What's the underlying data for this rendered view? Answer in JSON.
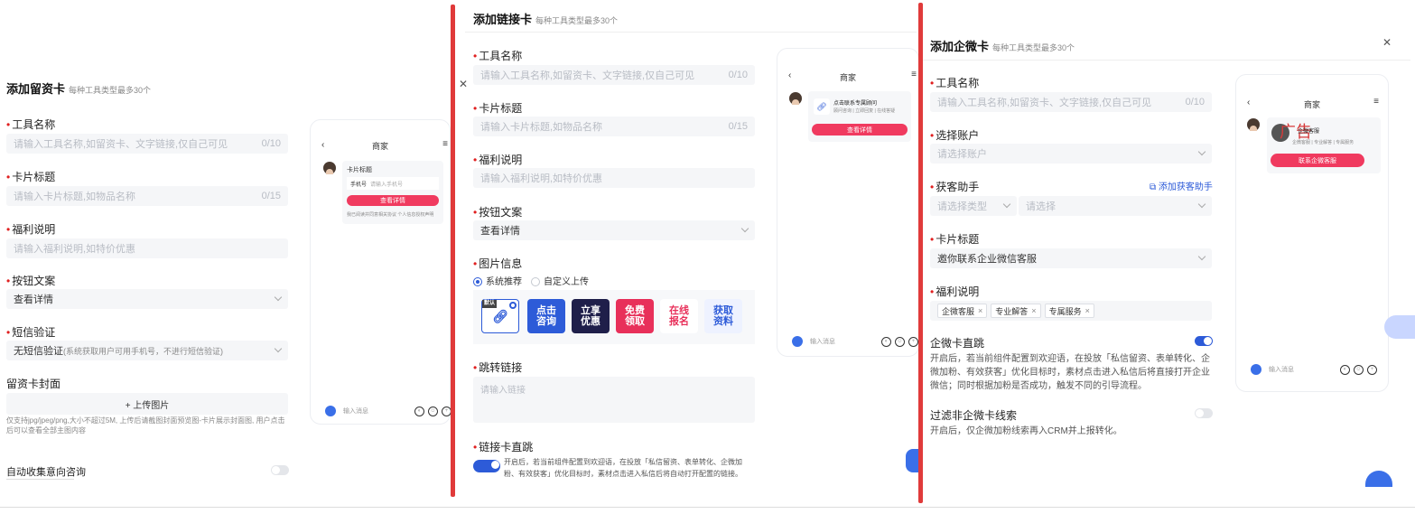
{
  "panel1": {
    "title": "添加留资卡",
    "subtitle": "每种工具类型最多30个",
    "field_name_label": "工具名称",
    "field_name_placeholder": "请输入工具名称,如留资卡、文字链接,仅自己可见",
    "field_name_count": "0/10",
    "card_title_label": "卡片标题",
    "card_title_placeholder": "请输入卡片标题,如物品名称",
    "card_title_count": "0/15",
    "benefit_label": "福利说明",
    "benefit_placeholder": "请输入福利说明,如特价优惠",
    "button_label": "按钮文案",
    "button_value": "查看详情",
    "sms_label": "短信验证",
    "sms_value": "无短信验证",
    "sms_note": "(系统获取用户可用手机号，不进行短信验证)",
    "cover_label": "留资卡封面",
    "upload_label": "+ 上传图片",
    "upload_hint": "仅支持jpg/jpeg/png,大小不超过5M, 上传后请截图封面预览图-卡片展示封面图, 用户点击后可以查看全部主图内容",
    "auto_collect_label": "自动收集意向咨询",
    "phone": {
      "header": "商家",
      "card_title": "卡片标题",
      "phone_label": "手机号",
      "phone_placeholder": "请输入手机号",
      "btn": "查看详情",
      "agree": "我已阅读并同意相关协议 个人信息授权声明",
      "input_placeholder": "输入消息"
    }
  },
  "panel2": {
    "title": "添加链接卡",
    "subtitle": "每种工具类型最多30个",
    "field_name_label": "工具名称",
    "field_name_placeholder": "请输入工具名称,如留资卡、文字链接,仅自己可见",
    "field_name_count": "0/10",
    "card_title_label": "卡片标题",
    "card_title_placeholder": "请输入卡片标题,如物品名称",
    "card_title_count": "0/15",
    "benefit_label": "福利说明",
    "benefit_placeholder": "请输入福利说明,如特价优惠",
    "button_label": "按钮文案",
    "button_value": "查看详情",
    "image_label": "图片信息",
    "radio_system": "系统推荐",
    "radio_custom": "自定义上传",
    "default_badge": "默认",
    "thumbs": [
      "点击咨询",
      "立享优惠",
      "免费领取",
      "在线报名",
      "获取资料"
    ],
    "jump_label": "跳转链接",
    "jump_placeholder": "请输入链接",
    "direct_label": "链接卡直跳",
    "direct_desc": "开启后，若当前组件配置到欢迎语，在投放「私信留资、表单转化、企微加粉、有效获客」优化目标时，素材点击进入私信后将自动打开配置的链接。",
    "phone": {
      "header": "商家",
      "card_line1": "点击联系专属顾问",
      "card_line2": "顾问咨询 | 立即回复 | 在线答疑",
      "btn": "查看详情",
      "input_placeholder": "输入消息"
    }
  },
  "panel3": {
    "title": "添加企微卡",
    "subtitle": "每种工具类型最多30个",
    "field_name_label": "工具名称",
    "field_name_placeholder": "请输入工具名称,如留资卡、文字链接,仅自己可见",
    "field_name_count": "0/10",
    "account_label": "选择账户",
    "account_placeholder": "请选择账户",
    "helper_label": "获客助手",
    "helper_add": "添加获客助手",
    "helper_type_placeholder": "请选择类型",
    "helper_placeholder": "请选择",
    "card_title_label": "卡片标题",
    "card_title_value": "邀你联系企业微信客服",
    "benefit_label": "福利说明",
    "tags": [
      "企微客服",
      "专业解答",
      "专属服务"
    ],
    "direct_label": "企微卡直跳",
    "direct_desc": "开启后，若当前组件配置到欢迎语，在投放「私信留资、表单转化、企微加粉、有效获客」优化目标时，素材点击进入私信后将直接打开企业微信；同时根据加粉是否成功，触发不同的引导流程。",
    "filter_label": "过滤非企微卡线索",
    "filter_desc": "开启后，仅企微加粉线索再入CRM并上报转化。",
    "phone": {
      "header": "商家",
      "watermark": "广告",
      "card_line1": "企微客服",
      "card_line2": "企微客服 | 专业解答 | 专属服务",
      "btn": "联系企微客服",
      "input_placeholder": "输入消息"
    }
  },
  "colors": {
    "accent": "#2d5bd8",
    "pink": "#f03a5f",
    "divider_red": "#e03a3a"
  }
}
